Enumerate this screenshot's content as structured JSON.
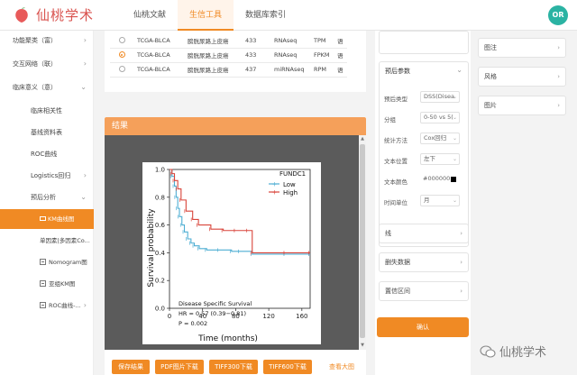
{
  "header": {
    "logo_text": "仙桃学术",
    "nav": [
      "仙桃文献",
      "生信工具",
      "数据库索引"
    ],
    "active_nav": "生信工具",
    "avatar": "OR"
  },
  "sidebar": {
    "items": [
      {
        "label": "功能聚类（富）",
        "type": "group",
        "chev": "›"
      },
      {
        "label": "交互网络（联）",
        "type": "group",
        "chev": "›"
      },
      {
        "label": "临床意义（意）",
        "type": "group",
        "chev": "⌄"
      },
      {
        "label": "临床相关性",
        "type": "sub"
      },
      {
        "label": "基线资料表",
        "type": "sub"
      },
      {
        "label": "ROC曲线",
        "type": "sub"
      },
      {
        "label": "Logistics回归",
        "type": "sub",
        "chev": "›"
      },
      {
        "label": "预后分析",
        "type": "sub",
        "chev": "⌄"
      },
      {
        "label": "KM曲线图",
        "type": "sub2",
        "active": true
      },
      {
        "label": "单因素|多因素Co...",
        "type": "sub2"
      },
      {
        "label": "Nomogram图",
        "type": "sub2",
        "box": true
      },
      {
        "label": "亚组KM图",
        "type": "sub2",
        "box": true
      },
      {
        "label": "ROC曲线-...",
        "type": "sub2",
        "box": true,
        "chev": "›"
      }
    ]
  },
  "data_table": {
    "rows": [
      {
        "selected": false,
        "project": "TCGA-BLCA",
        "cancer": "膀胱尿路上皮癌",
        "n": "433",
        "type": "RNAseq",
        "unit": "TPM",
        "extra": "语"
      },
      {
        "selected": true,
        "project": "TCGA-BLCA",
        "cancer": "膀胱尿路上皮癌",
        "n": "433",
        "type": "RNAseq",
        "unit": "FPKM",
        "extra": "语"
      },
      {
        "selected": false,
        "project": "TCGA-BLCA",
        "cancer": "膀胱尿路上皮癌",
        "n": "437",
        "type": "miRNAseq",
        "unit": "RPM",
        "extra": "语"
      }
    ]
  },
  "result": {
    "title": "结果",
    "buttons": [
      "保存结果",
      "PDF图片下载",
      "TIFF300下载",
      "TIFF600下载"
    ],
    "view_large": "查看大图"
  },
  "chart_data": {
    "type": "line",
    "subtype": "kaplan-meier",
    "xlabel": "Time (months)",
    "ylabel": "Survival probability",
    "xticks": [
      0,
      40,
      80,
      120,
      160
    ],
    "yticks": [
      "0.0",
      "0.2",
      "0.4",
      "0.6",
      "0.8",
      "1.0"
    ],
    "xlim": [
      0,
      170
    ],
    "ylim": [
      0,
      1.0
    ],
    "legend_title": "FUNDC1",
    "legend_position": "top-right",
    "series": [
      {
        "name": "Low",
        "color": "#4eaed3",
        "x": [
          0,
          3,
          6,
          8,
          10,
          12,
          15,
          18,
          22,
          26,
          30,
          36,
          45,
          60,
          75,
          85,
          100,
          140,
          170
        ],
        "y": [
          1.0,
          0.95,
          0.88,
          0.8,
          0.72,
          0.66,
          0.6,
          0.55,
          0.5,
          0.47,
          0.45,
          0.43,
          0.42,
          0.42,
          0.41,
          0.41,
          0.39,
          0.39,
          0.39
        ]
      },
      {
        "name": "High",
        "color": "#d9443a",
        "x": [
          0,
          3,
          6,
          10,
          14,
          20,
          28,
          35,
          50,
          65,
          80,
          95,
          100,
          140,
          170
        ],
        "y": [
          1.0,
          0.97,
          0.92,
          0.86,
          0.78,
          0.7,
          0.64,
          0.6,
          0.57,
          0.56,
          0.56,
          0.56,
          0.4,
          0.4,
          0.4
        ]
      }
    ],
    "annotations": [
      "Disease Specific Survival",
      "HR = 0.57 (0.39−0.81)",
      "P = 0.002"
    ]
  },
  "params": {
    "title": "预后参数",
    "fields": [
      {
        "label": "预后类型",
        "value": "DSS(Disea"
      },
      {
        "label": "分组",
        "value": "0-50 vs 5("
      },
      {
        "label": "统计方法",
        "value": "Cox回归"
      },
      {
        "label": "文本位置",
        "value": "左下"
      },
      {
        "label": "文本颜色",
        "value": "#000000",
        "swatch": "#000000"
      },
      {
        "label": "时间单位",
        "value": "月"
      }
    ],
    "sections": [
      "线",
      "删失数据",
      "置信区间"
    ],
    "confirm": "确认"
  },
  "right_panel": {
    "items": [
      "图注",
      "风格",
      "图片"
    ]
  },
  "watermark": "仙桃学术",
  "colors": {
    "accent": "#f08a24",
    "low": "#4eaed3",
    "high": "#d9443a"
  }
}
